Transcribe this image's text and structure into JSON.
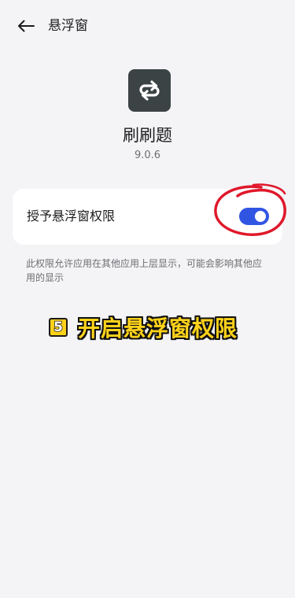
{
  "header": {
    "back_icon": "arrow-left-icon",
    "title": "悬浮窗"
  },
  "app": {
    "icon": "swap-arrows-icon",
    "icon_color": "#3b4345",
    "name": "刷刷题",
    "version": "9.0.6"
  },
  "permission": {
    "label": "授予悬浮窗权限",
    "toggle_on": true,
    "toggle_color": "#3155e3",
    "description": "此权限允许应用在其他应用上层显示，可能会影响其他应用的显示"
  },
  "annotation": {
    "step_number": "5",
    "step_text": "开启悬浮窗权限",
    "highlight_color": "#e0182b",
    "badge_color": "#ffd21a"
  }
}
